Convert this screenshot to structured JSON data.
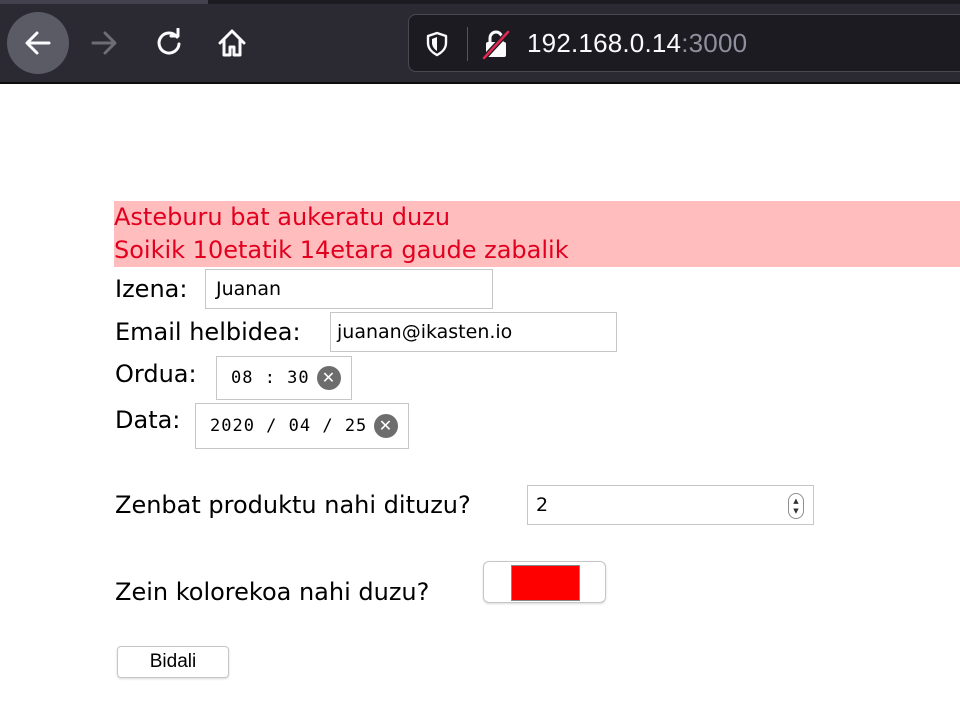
{
  "browser": {
    "url_host": "192.168.0.14",
    "url_port": ":3000"
  },
  "alert": {
    "line1": "Asteburu bat aukeratu duzu",
    "line2": "Soikik 10etatik 14etara gaude zabalik"
  },
  "form": {
    "name_label": "Izena:",
    "name_value": "Juanan",
    "email_label": "Email helbidea:",
    "email_value": "juanan@ikasten.io",
    "time_label": "Ordua:",
    "time_value": "08 : 30",
    "date_label": "Data:",
    "date_value": "2020 / 04 / 25",
    "quantity_label": "Zenbat produktu nahi dituzu?",
    "quantity_value": "2",
    "color_label": "Zein kolorekoa nahi duzu?",
    "color_value": "#ff0000",
    "submit_label": "Bidali"
  },
  "colors": {
    "alert_bg": "#ffbdbd",
    "alert_text": "#e1001f",
    "toolbar": "#2b2a33"
  }
}
